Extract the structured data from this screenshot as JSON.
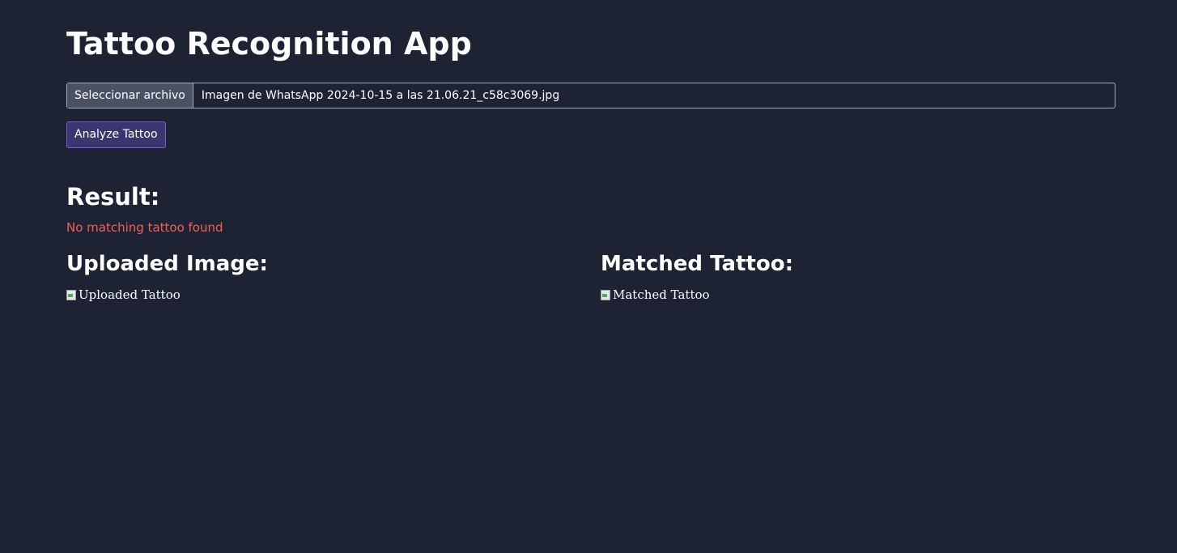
{
  "header": {
    "title": "Tattoo Recognition App"
  },
  "upload": {
    "choose_file_label": "Seleccionar archivo",
    "file_name": "Imagen de WhatsApp 2024-10-15 a las 21.06.21_c58c3069.jpg"
  },
  "actions": {
    "analyze_label": "Analyze Tattoo"
  },
  "result": {
    "heading": "Result:",
    "message": "No matching tattoo found",
    "message_color": "#f0605a"
  },
  "uploaded": {
    "heading": "Uploaded Image:",
    "alt_text": "Uploaded Tattoo"
  },
  "matched": {
    "heading": "Matched Tattoo:",
    "alt_text": "Matched Tattoo"
  },
  "colors": {
    "background": "#1e2333",
    "accent_button": "#3a3670",
    "accent_border": "#6e62d8"
  }
}
